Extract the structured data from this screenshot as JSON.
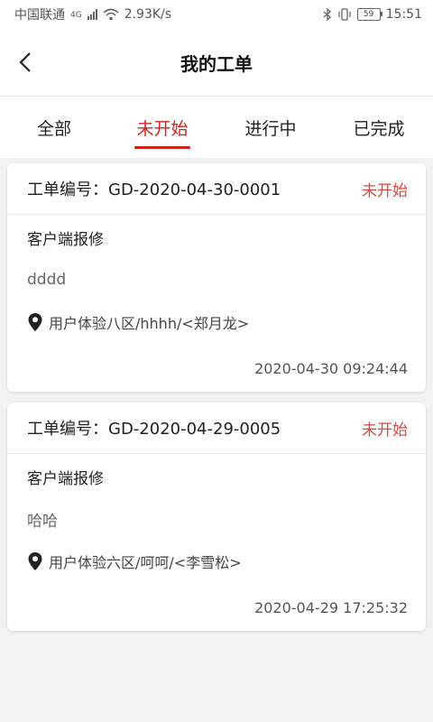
{
  "status_bar": {
    "carrier": "中国联通",
    "network": "4G",
    "speed": "2.93K/s",
    "battery": "59",
    "time": "15:51"
  },
  "header": {
    "title": "我的工单"
  },
  "tabs": [
    {
      "label": "全部"
    },
    {
      "label": "未开始"
    },
    {
      "label": "进行中"
    },
    {
      "label": "已完成"
    }
  ],
  "active_tab": "未开始",
  "colors": {
    "accent": "#d0211c",
    "status": "#e0453f"
  },
  "orders": [
    {
      "number": "工单编号：GD-2020-04-30-0001",
      "status": "未开始",
      "type": "客户端报修",
      "description": "dddd",
      "location": "用户体验八区/hhhh/<郑月龙>",
      "time": "2020-04-30 09:24:44"
    },
    {
      "number": "工单编号：GD-2020-04-29-0005",
      "status": "未开始",
      "type": "客户端报修",
      "description": "哈哈",
      "location": "用户体验六区/呵呵/<李雪松>",
      "time": "2020-04-29 17:25:32"
    }
  ]
}
